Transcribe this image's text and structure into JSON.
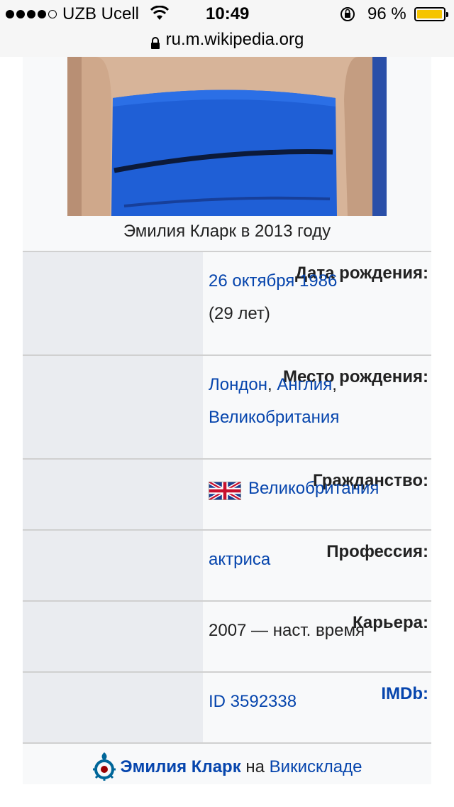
{
  "status_bar": {
    "carrier": "UZB Ucell",
    "time": "10:49",
    "battery_percent": "96 %",
    "signal_strength_of_5": 4,
    "battery_level": 0.96
  },
  "browser": {
    "url": "ru.m.wikipedia.org"
  },
  "infobox": {
    "caption": "Эмилия Кларк в 2013 году",
    "rows": [
      {
        "label": "Дата рождения:",
        "value_link": "26 октября 1986",
        "value_extra": "(29 лет)"
      },
      {
        "label": "Место рождения:",
        "link1": "Лондон",
        "sep1": ", ",
        "link2": "Англия",
        "sep2": ",",
        "link3": "Великобритания"
      },
      {
        "label": "Гражданство:",
        "value_link": "Великобритания",
        "flag_icon": "uk-flag-icon"
      },
      {
        "label": "Профессия:",
        "value_link": "актриса"
      },
      {
        "label": "Карьера:",
        "value_text": "2007 — наст. время"
      },
      {
        "label": "IMDb:",
        "value_link": "ID 3592338"
      }
    ],
    "commons": {
      "name": "Эмилия Кларк",
      "middle": " на ",
      "link": "Викискладе",
      "icon": "wikimedia-commons-icon"
    }
  },
  "colors": {
    "link": "#0645ad",
    "label_bg": "#eaecf0",
    "box_bg": "#f8f9fa",
    "dress": "#1f5fd6"
  }
}
